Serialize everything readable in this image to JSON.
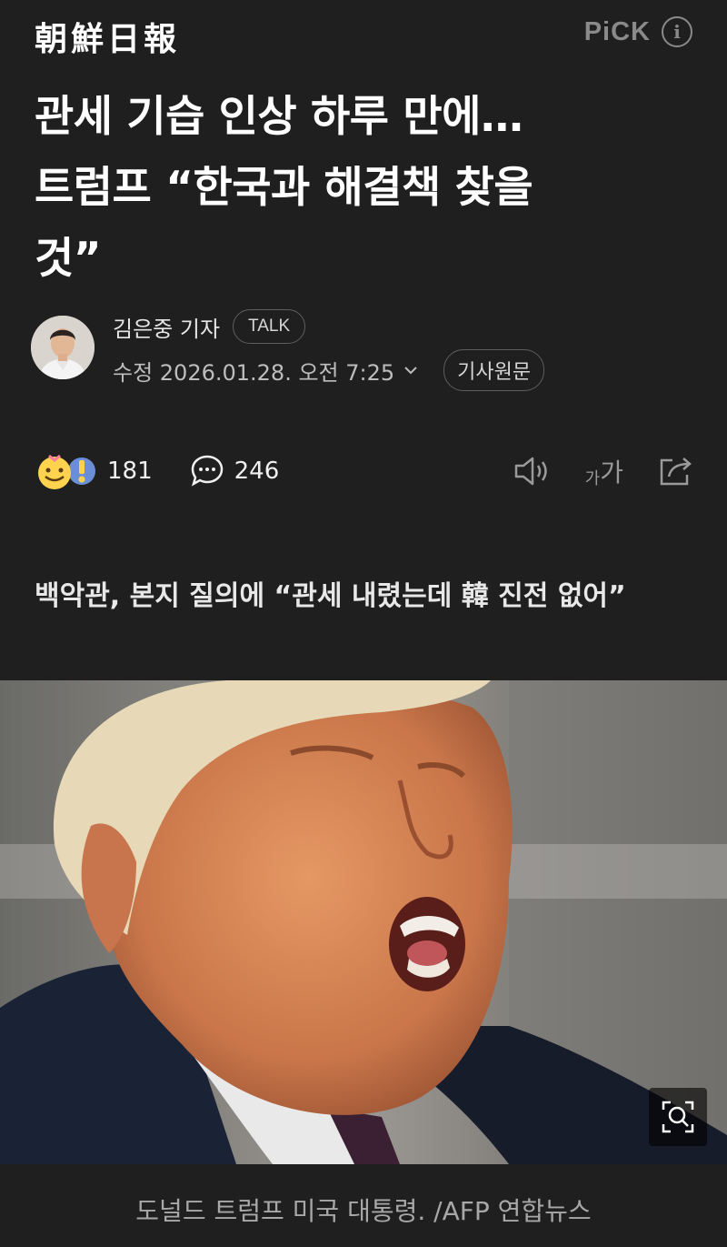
{
  "header": {
    "logo_text": "朝鮮日報",
    "pick_label": "PiCK",
    "info_icon": "info-icon"
  },
  "article": {
    "headline_lines": [
      "관세 기습 인상 하루 만에…",
      "트럼프 “한국과 해결책 찾을",
      "것”"
    ],
    "reporter_name": "김은중 기자",
    "talk_label": "TALK",
    "date_text": "수정 2026.01.28. 오전 7:25",
    "original_label": "기사원문",
    "reaction_count": "181",
    "comment_count": "246",
    "font_size_small": "가",
    "font_size_large": "가",
    "subheadline": "백악관, 본지 질의에 “관세 내렸는데 韓 진전 없어”",
    "photo_caption": "도널드 트럼프 미국 대통령. /AFP 연합뉴스"
  },
  "colors": {
    "background": "#1f1f1f",
    "text": "#f2f2f2",
    "muted": "#8a8a8a"
  }
}
